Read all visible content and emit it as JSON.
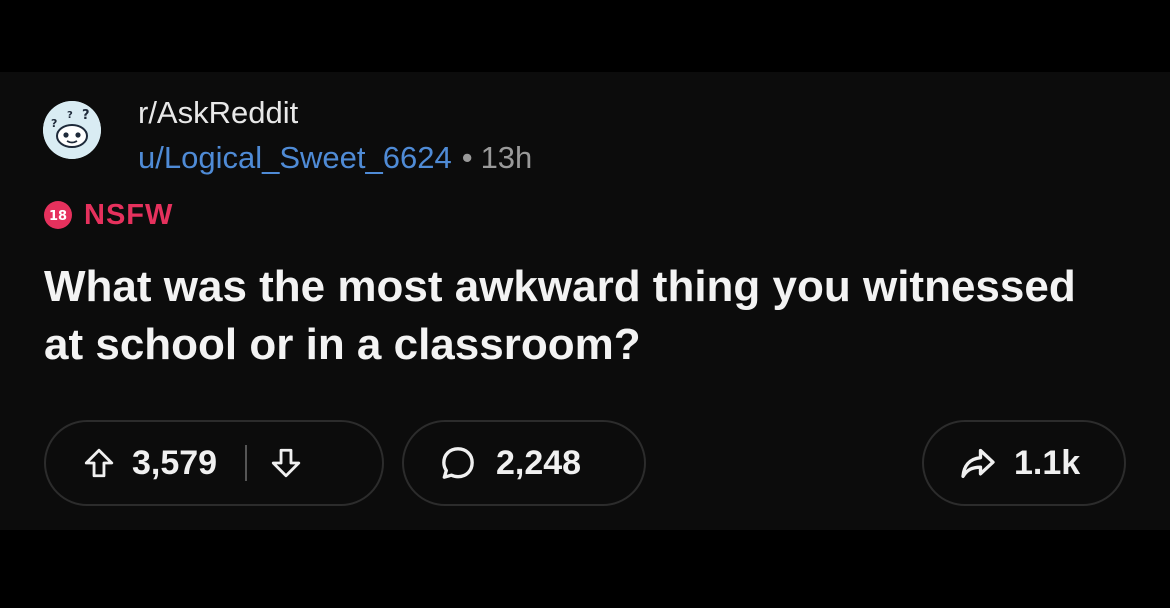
{
  "post": {
    "subreddit": "r/AskReddit",
    "username": "u/Logical_Sweet_6624",
    "separator": "•",
    "age": "13h",
    "nsfw_badge_text": "18",
    "nsfw_label": "NSFW",
    "title": "What was the most awkward thing you witnessed at school or in a classroom?"
  },
  "actions": {
    "upvote_count": "3,579",
    "comment_count": "2,248",
    "share_count": "1.1k"
  },
  "icons": {
    "upvote": "arrow-up-icon",
    "downvote": "arrow-down-icon",
    "comment": "speech-bubble-icon",
    "share": "share-arrow-icon"
  },
  "colors": {
    "background": "#0c0c0c",
    "text": "#f3f3f3",
    "username": "#4f8bd6",
    "nsfw": "#e6315d",
    "muted": "#9a9a9a",
    "pill_border": "#2c2c2c"
  }
}
